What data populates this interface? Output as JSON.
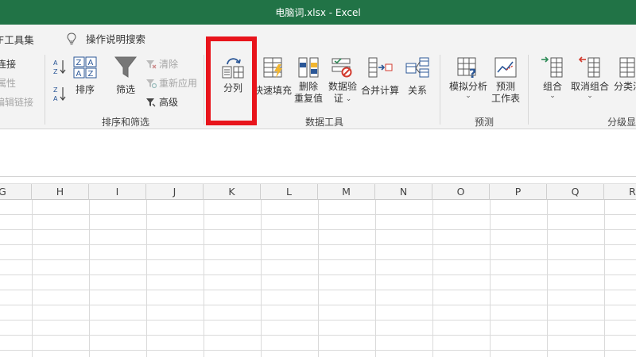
{
  "window": {
    "title": "电脑词.xlsx  -  Excel"
  },
  "menu": {
    "tab_partial": "F工具集",
    "tell_me": "操作说明搜索"
  },
  "ribbon": {
    "connections": {
      "item1": "连接",
      "item2": "属性",
      "item3": "编辑链接"
    },
    "sort_filter": {
      "sort_az_label": "A↓Z",
      "sort_label": "排序",
      "filter_label": "筛选",
      "clear_label": "清除",
      "reapply_label": "重新应用",
      "advanced_label": "高级",
      "group_label": "排序和筛选"
    },
    "data_tools": {
      "text_to_columns": "分列",
      "flash_fill": "快速填充",
      "remove_dup_line1": "删除",
      "remove_dup_line2": "重复值",
      "validation_line1": "数据验",
      "validation_line2": "证",
      "consolidate": "合并计算",
      "relationships": "关系",
      "group_label": "数据工具"
    },
    "forecast": {
      "what_if": "模拟分析",
      "forecast_line1": "预测",
      "forecast_line2": "工作表",
      "group_label": "预测"
    },
    "outline": {
      "group": "组合",
      "ungroup": "取消组合",
      "subtotal": "分类汇",
      "group_label": "分级显"
    }
  },
  "sheet": {
    "columns": [
      "G",
      "H",
      "I",
      "J",
      "K",
      "L",
      "M",
      "N",
      "O",
      "P",
      "Q",
      "R"
    ]
  },
  "colors": {
    "title_bar": "#217346",
    "highlight": "#e8141b",
    "ribbon_bg": "#f3f3f3"
  }
}
